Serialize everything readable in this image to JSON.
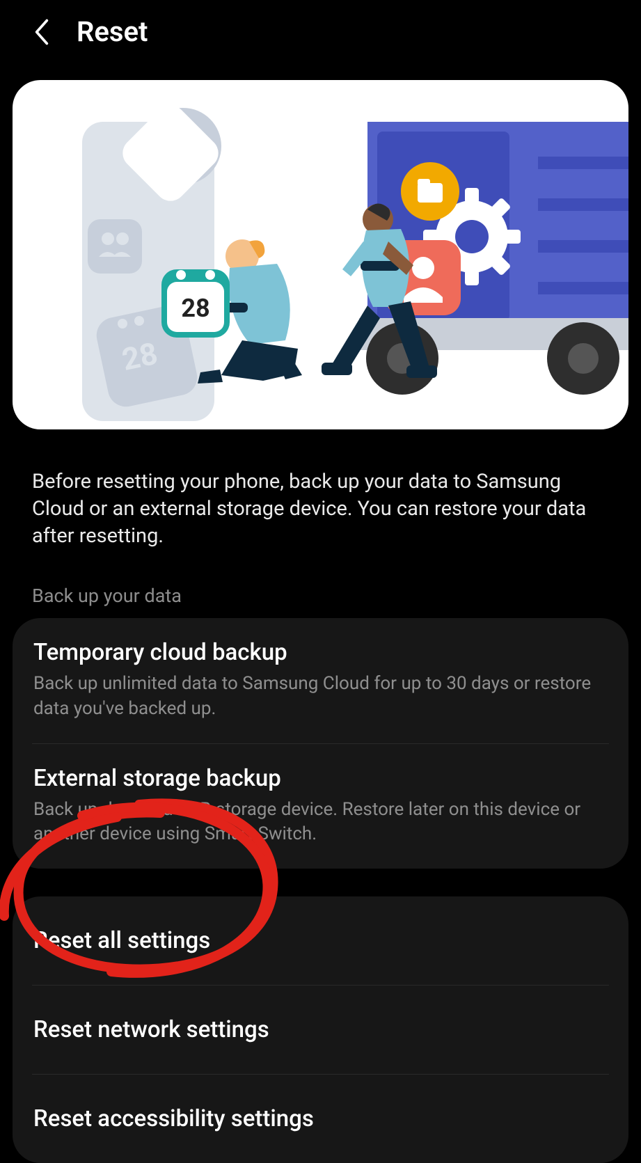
{
  "header": {
    "title": "Reset"
  },
  "intro": "Before resetting your phone, back up your data to Samsung Cloud or an external storage device. You can restore your data after resetting.",
  "backup": {
    "section_label": "Back up your data",
    "items": [
      {
        "title": "Temporary cloud backup",
        "sub": "Back up unlimited data to Samsung Cloud for up to 30 days or restore data you've backed up."
      },
      {
        "title": "External storage backup",
        "sub": "Back up data to a USB storage device. Restore later on this device or another device using Smart Switch."
      }
    ]
  },
  "reset": {
    "items": [
      {
        "title": "Reset all settings"
      },
      {
        "title": "Reset network settings"
      },
      {
        "title": "Reset accessibility settings"
      }
    ]
  },
  "illustration": {
    "calendar_day": "28",
    "phone_calendar_day": "28"
  }
}
